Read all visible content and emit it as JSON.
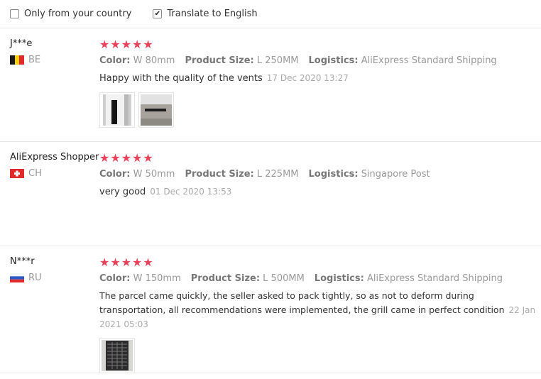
{
  "filters": {
    "country_label": "Only from your country",
    "country_checked": false,
    "translate_label": "Translate to English",
    "translate_checked": true
  },
  "labels": {
    "color": "Color:",
    "size": "Product Size:",
    "logistics": "Logistics:"
  },
  "reviews": [
    {
      "user": "J***e",
      "country": "BE",
      "stars": "★★★★★",
      "color": "W 80mm",
      "size": "L 250MM",
      "logistics": "AliExpress Standard Shipping",
      "text": "Happy with the quality of the vents",
      "date": "17 Dec 2020 13:27",
      "photos": [
        "vent-photo",
        "vent-installed-photo"
      ]
    },
    {
      "user": "AliExpress Shopper",
      "country": "CH",
      "stars": "★★★★★",
      "color": "W 50mm",
      "size": "L 225MM",
      "logistics": "Singapore Post",
      "text": "very good",
      "date": "01 Dec 2020 13:53",
      "photos": []
    },
    {
      "user": "N***r",
      "country": "RU",
      "stars": "★★★★★",
      "color": "W 150mm",
      "size": "L 500MM",
      "logistics": "AliExpress Standard Shipping",
      "text": "The parcel came quickly, the seller asked to pack tightly, so as not to deform during transportation, all recommendations were implemented, the grill came in perfect condition",
      "date": "22 Jan 2021 05:03",
      "photos": [
        "grill-photo"
      ]
    }
  ]
}
